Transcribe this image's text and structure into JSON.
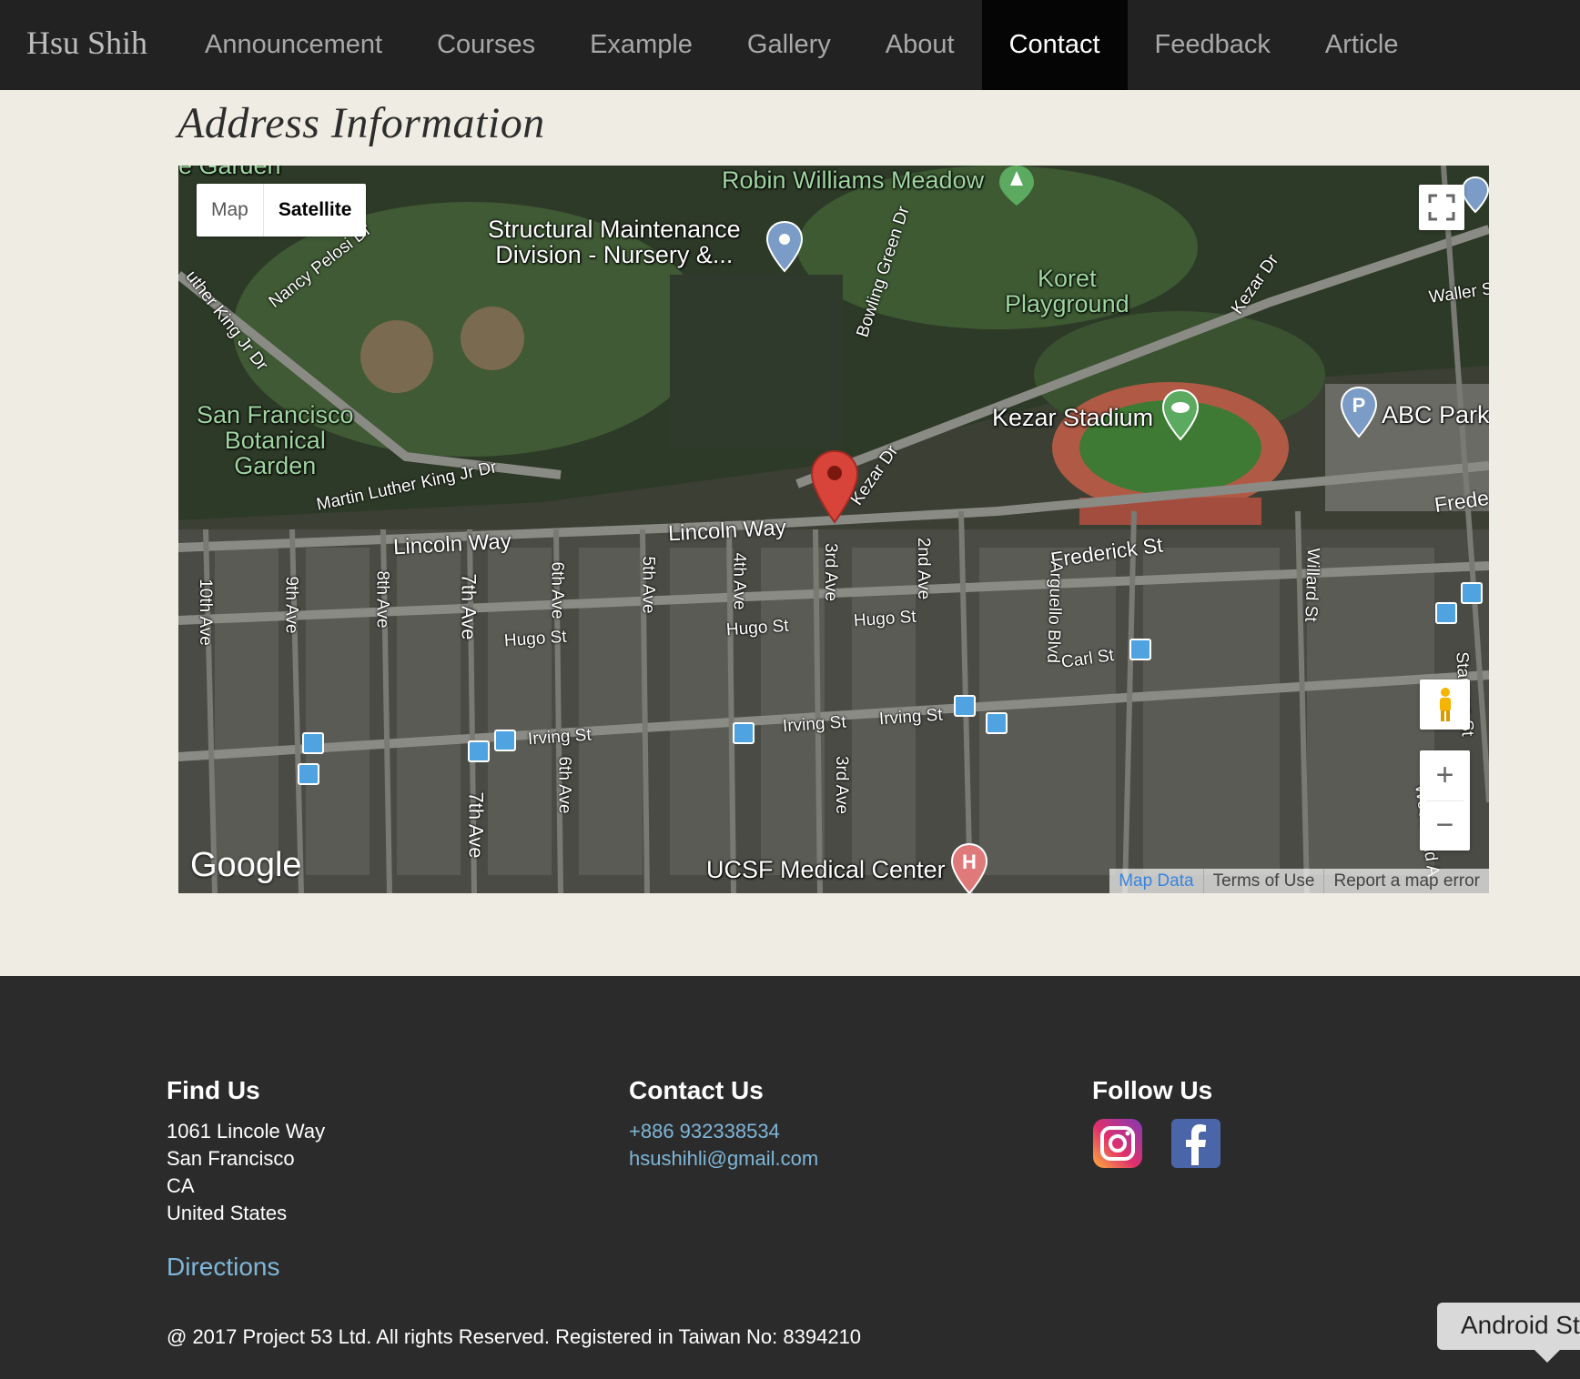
{
  "nav": {
    "brand": "Hsu Shih",
    "items": [
      {
        "label": "Announcement",
        "active": false
      },
      {
        "label": "Courses",
        "active": false
      },
      {
        "label": "Example",
        "active": false
      },
      {
        "label": "Gallery",
        "active": false
      },
      {
        "label": "About",
        "active": false
      },
      {
        "label": "Contact",
        "active": true
      },
      {
        "label": "Feedback",
        "active": false
      },
      {
        "label": "Article",
        "active": false
      }
    ]
  },
  "main": {
    "title": "Address Information"
  },
  "map": {
    "type_controls": {
      "map": "Map",
      "satellite": "Satellite",
      "selected": "Satellite"
    },
    "logo": "Google",
    "attribution": {
      "map_data": "Map Data",
      "terms": "Terms of Use",
      "report": "Report a map error"
    },
    "zoom_in": "+",
    "zoom_out": "−",
    "places": {
      "robin": "Robin Williams Meadow",
      "structural": "Structural Maintenance\nDivision - Nursery &...",
      "koret": "Koret\nPlayground",
      "botanical": "San Francisco\nBotanical\nGarden",
      "kezar_stadium": "Kezar Stadium",
      "abc_park": "ABC Park",
      "ucsf": "UCSF Medical Center",
      "garden_partial": "e Garden"
    },
    "streets": {
      "lincoln1": "Lincoln Way",
      "lincoln2": "Lincoln Way",
      "mlk": "Martin Luther King Jr Dr",
      "mlk_top": "uther King Jr Dr",
      "pelosi": "Nancy Pelosi Dr",
      "kezar1": "Kezar Dr",
      "kezar2": "Kezar Dr",
      "bowling": "Bowling Green Dr",
      "frederick": "Frederick St",
      "frede_partial": "Frede",
      "waller": "Waller S",
      "hugo1": "Hugo St",
      "hugo2": "Hugo St",
      "hugo3": "Hugo St",
      "carl": "Carl St",
      "irving1": "Irving St",
      "irving2": "Irving St",
      "irving3": "Irving St",
      "stanyan": "Stanyan St",
      "willard": "Willard St",
      "arguello": "Arguello Blvd",
      "woodland": "Woodland A",
      "ave10": "10th Ave",
      "ave9": "9th Ave",
      "ave8": "8th Ave",
      "ave7": "7th Ave",
      "ave7b": "7th Ave",
      "ave6": "6th Ave",
      "ave6b": "6th Ave",
      "ave5": "5th Ave",
      "ave4": "4th Ave",
      "ave3": "3rd Ave",
      "ave3b": "3rd Ave",
      "ave2": "2nd Ave"
    }
  },
  "footer": {
    "find": {
      "heading": "Find Us",
      "lines": [
        "1061 Lincole Way",
        "San Francisco",
        "CA",
        "United States"
      ],
      "directions": "Directions"
    },
    "contact": {
      "heading": "Contact Us",
      "phone": "+886 932338534",
      "email": "hsushihli@gmail.com"
    },
    "follow": {
      "heading": "Follow Us",
      "icons": [
        "instagram-icon",
        "facebook-icon"
      ]
    },
    "copyright": "@ 2017 Project 53 Ltd. All rights Reserved. Registered in Taiwan No: 8394210"
  },
  "tooltip": {
    "text": "Android St"
  },
  "colors": {
    "nav_bg": "#222222",
    "nav_active_bg": "#050505",
    "page_bg": "#efede3",
    "footer_bg": "#2b2b2b",
    "link": "#7fb6d8",
    "marker": "#d9443a"
  }
}
